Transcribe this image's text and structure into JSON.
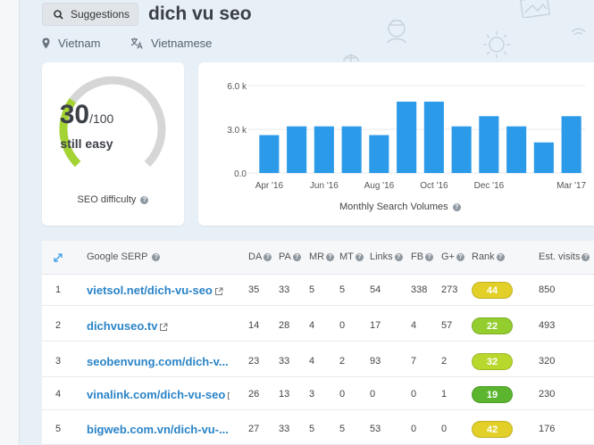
{
  "header": {
    "suggestions_label": "Suggestions",
    "keyword": "dich vu seo",
    "location": "Vietnam",
    "language": "Vietnamese"
  },
  "seo": {
    "score": "30",
    "max": "/100",
    "label": "still easy",
    "value_fraction": 0.3,
    "caption": "SEO difficulty",
    "color_fill": "#a4d334",
    "color_track": "#d6d6d6"
  },
  "search_volume": {
    "caption": "Monthly Search Volumes"
  },
  "chart_data": {
    "type": "bar",
    "categories": [
      "Apr '16",
      "May '16",
      "Jun '16",
      "Jul '16",
      "Aug '16",
      "Sep '16",
      "Oct '16",
      "Nov '16",
      "Dec '16",
      "Jan '17",
      "Feb '17",
      "Mar '17"
    ],
    "tick_labels": [
      "Apr '16",
      "",
      "Jun '16",
      "",
      "Aug '16",
      "",
      "Oct '16",
      "",
      "Dec '16",
      "",
      "",
      "Mar '17"
    ],
    "values": [
      2600,
      3200,
      3200,
      3200,
      2600,
      4900,
      4900,
      3200,
      3900,
      3200,
      2100,
      3900
    ],
    "y_ticks": [
      "0.0",
      "3.0 k",
      "6.0 k"
    ],
    "ylim": [
      0,
      6000
    ],
    "color": "#2b9ae8"
  },
  "table": {
    "headers": {
      "google_serp": "Google SERP",
      "da": "DA",
      "pa": "PA",
      "mr": "MR",
      "mt": "MT",
      "links": "Links",
      "fb": "FB",
      "gplus": "G+",
      "rank": "Rank",
      "visits": "Est. visits"
    },
    "rows": [
      {
        "n": "1",
        "url": "vietsol.net/dich-vu-seo",
        "da": "35",
        "pa": "33",
        "mr": "5",
        "mt": "5",
        "links": "54",
        "fb": "338",
        "gplus": "273",
        "rank": "44",
        "rank_color": "#e2d028",
        "visits": "850"
      },
      {
        "n": "2",
        "url": "dichvuseo.tv",
        "da": "14",
        "pa": "28",
        "mr": "4",
        "mt": "0",
        "links": "17",
        "fb": "4",
        "gplus": "57",
        "rank": "22",
        "rank_color": "#93cd2e",
        "visits": "493"
      },
      {
        "n": "3",
        "url": "seobenvung.com/dich-v...",
        "da": "23",
        "pa": "33",
        "mr": "4",
        "mt": "2",
        "links": "93",
        "fb": "7",
        "gplus": "2",
        "rank": "32",
        "rank_color": "#b8d82e",
        "visits": "320"
      },
      {
        "n": "4",
        "url": "vinalink.com/dich-vu-seo",
        "da": "26",
        "pa": "13",
        "mr": "3",
        "mt": "0",
        "links": "0",
        "fb": "0",
        "gplus": "1",
        "rank": "19",
        "rank_color": "#5bb52e",
        "visits": "230"
      },
      {
        "n": "5",
        "url": "bigweb.com.vn/dich-vu-...",
        "da": "27",
        "pa": "33",
        "mr": "5",
        "mt": "5",
        "links": "53",
        "fb": "0",
        "gplus": "0",
        "rank": "42",
        "rank_color": "#e2d028",
        "visits": "176"
      }
    ]
  }
}
